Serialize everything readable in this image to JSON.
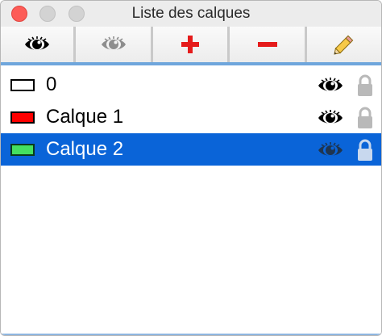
{
  "window": {
    "title": "Liste des calques"
  },
  "toolbar": {
    "buttons": [
      {
        "name": "show-all",
        "icon": "eye-icon",
        "color": "#000000"
      },
      {
        "name": "hide-all",
        "icon": "eye-icon",
        "color": "#8e8e8e"
      },
      {
        "name": "add-layer",
        "icon": "plus-icon",
        "color": "#e51b1b"
      },
      {
        "name": "remove-layer",
        "icon": "minus-icon",
        "color": "#e51b1b"
      },
      {
        "name": "edit-layer",
        "icon": "pencil-icon",
        "color": "#f0a020"
      }
    ]
  },
  "layers": [
    {
      "label": "0",
      "swatch_color": "#ffffff",
      "visible": true,
      "locked": false,
      "selected": false
    },
    {
      "label": "Calque 1",
      "swatch_color": "#ff0000",
      "visible": true,
      "locked": false,
      "selected": false
    },
    {
      "label": "Calque 2",
      "swatch_color": "#44e060",
      "visible": true,
      "locked": false,
      "selected": true
    }
  ],
  "colors": {
    "selection": "#0a64d8",
    "accent_border": "#6fa6dc",
    "lock_inactive": "#b9b9b9"
  }
}
